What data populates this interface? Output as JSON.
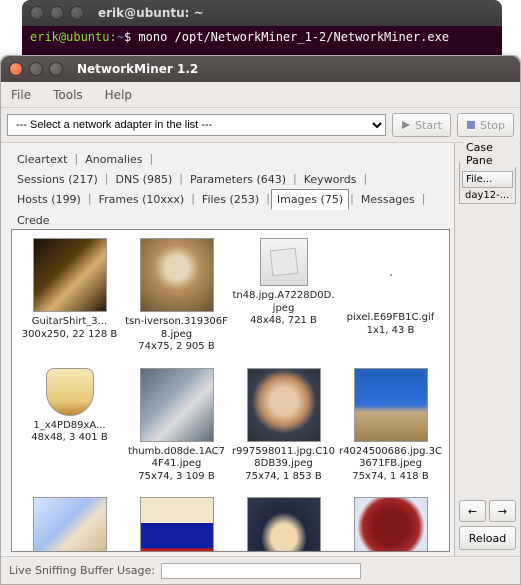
{
  "terminal": {
    "title": "erik@ubuntu: ~",
    "prompt_user": "erik@ubuntu",
    "prompt_sep": ":",
    "prompt_path": "~",
    "prompt_sigil": "$",
    "command": "mono /opt/NetworkMiner_1-2/NetworkMiner.exe"
  },
  "window": {
    "title": "NetworkMiner 1.2"
  },
  "menu": {
    "file": "File",
    "tools": "Tools",
    "help": "Help"
  },
  "toolbar": {
    "adapter_placeholder": "--- Select a network adapter in the list ---",
    "start": "Start",
    "stop": "Stop"
  },
  "tabs": {
    "cleartext": "Cleartext",
    "anomalies": "Anomalies",
    "sessions": "Sessions (217)",
    "dns": "DNS (985)",
    "parameters": "Parameters (643)",
    "keywords": "Keywords",
    "hosts": "Hosts (199)",
    "frames": "Frames (10xxx)",
    "files": "Files (253)",
    "images": "Images (75)",
    "messages": "Messages",
    "credentials": "Crede"
  },
  "images": {
    "items": [
      {
        "name": "GuitarShirt_3...",
        "meta": "300x250, 22 128 B",
        "cls": "t0"
      },
      {
        "name": "tsn-iverson.319306F8.jpeg",
        "meta": "74x75, 2 905 B",
        "cls": "t1"
      },
      {
        "name": "tn48.jpg.A7228D0D.jpeg",
        "meta": "48x48, 721 B",
        "cls": "t2",
        "size": "small"
      },
      {
        "name": "pixel.E69FB1C.gif",
        "meta": "1x1, 43 B",
        "cls": "",
        "size": "tiny"
      },
      {
        "name": "1_x4PD89xA...",
        "meta": "48x48, 3 401 B",
        "cls": "t4",
        "size": "small"
      },
      {
        "name": "thumb.d08de.1AC74F41.jpeg",
        "meta": "75x74, 3 109 B",
        "cls": "t5"
      },
      {
        "name": "r997598011.jpg.C108DB39.jpeg",
        "meta": "75x74, 1 853 B",
        "cls": "t6"
      },
      {
        "name": "r4024500686.jpg.3C3671FB.jpeg",
        "meta": "75x74, 1 418 B",
        "cls": "t7"
      },
      {
        "name": "",
        "meta": "",
        "cls": "t8"
      },
      {
        "name": "",
        "meta": "",
        "cls": "t9"
      },
      {
        "name": "",
        "meta": "",
        "cls": "t10"
      },
      {
        "name": "",
        "meta": "",
        "cls": "t11"
      }
    ]
  },
  "side": {
    "case_panel": "Case Pane",
    "file_header": "File...",
    "file_item": "day12-...",
    "reload": "Reload",
    "left": "←",
    "right": "→"
  },
  "status": {
    "buffer_label": "Live Sniffing Buffer Usage:"
  }
}
